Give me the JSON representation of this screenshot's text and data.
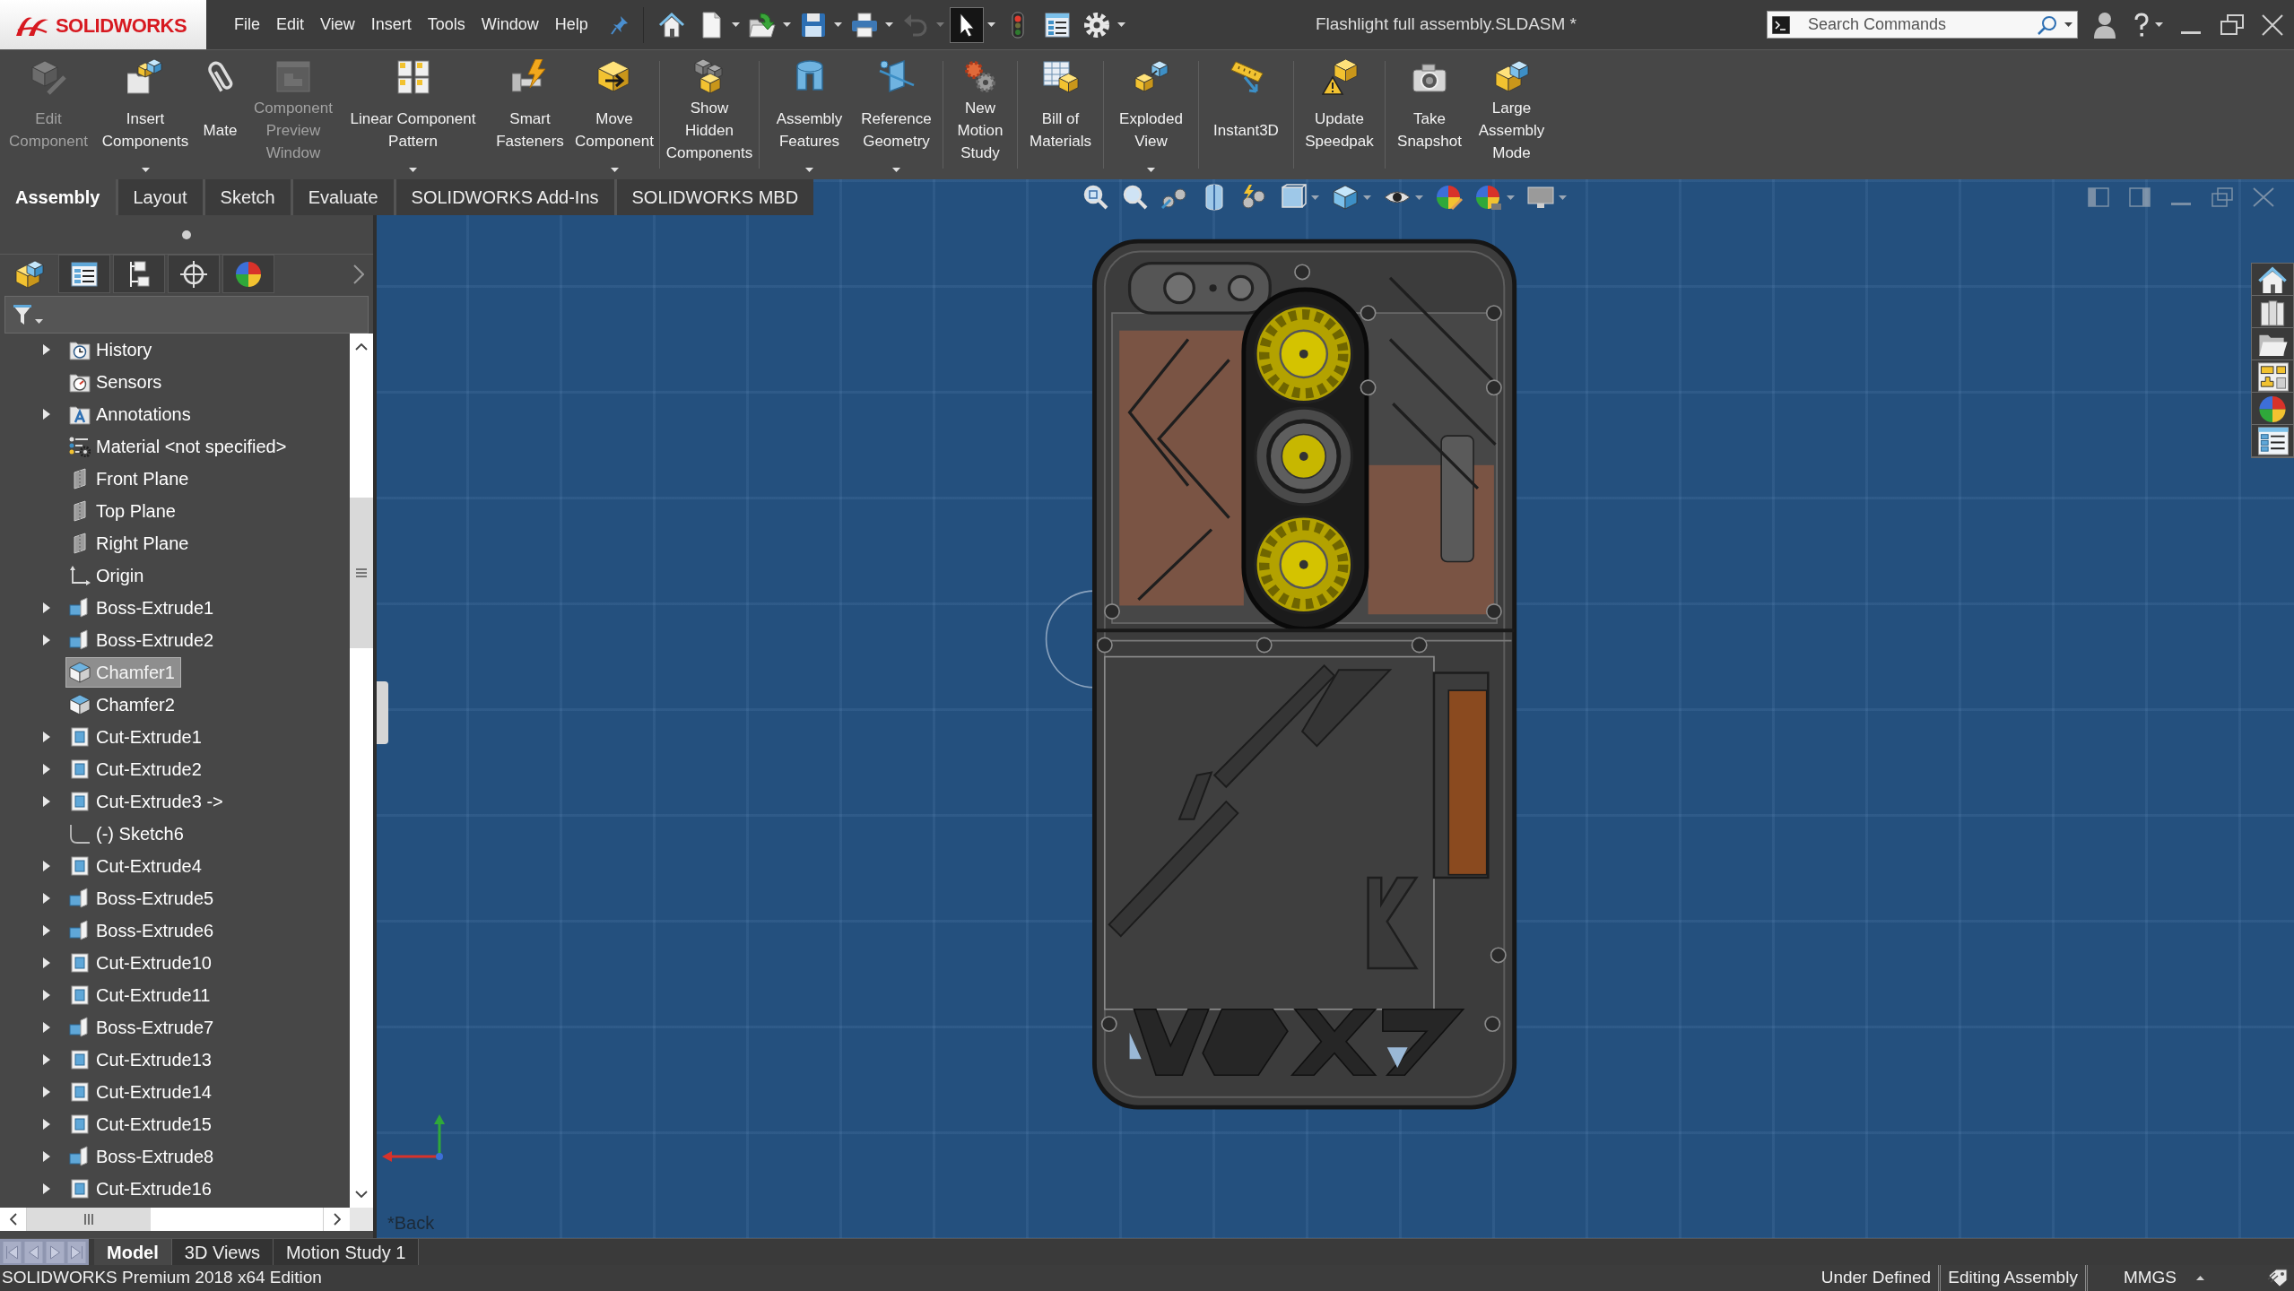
{
  "title_bar": {
    "logo": "SOLIDWORKS",
    "menu": [
      "File",
      "Edit",
      "View",
      "Insert",
      "Tools",
      "Window",
      "Help"
    ],
    "quick_access": [
      {
        "dropdown": false,
        "disabled": false,
        "selected": false
      },
      {
        "dropdown": true,
        "disabled": false,
        "selected": false
      },
      {
        "dropdown": true,
        "disabled": false,
        "selected": false
      },
      {
        "dropdown": true,
        "disabled": false,
        "selected": false
      },
      {
        "dropdown": true,
        "disabled": false,
        "selected": false
      },
      {
        "dropdown": true,
        "disabled": true,
        "selected": false
      },
      {
        "dropdown": true,
        "disabled": false,
        "selected": true
      },
      {
        "dropdown": false,
        "disabled": false,
        "selected": false
      },
      {
        "dropdown": false,
        "disabled": false,
        "selected": false
      },
      {
        "dropdown": true,
        "disabled": false,
        "selected": false
      }
    ],
    "document_title": "Flashlight full assembly.SLDASM *",
    "search": {
      "placeholder": "Search Commands"
    }
  },
  "ribbon": {
    "groups": [
      {
        "items": [
          {
            "label": "Edit Component",
            "disabled": true,
            "dropdown": false
          },
          {
            "label": "Insert Components",
            "disabled": false,
            "dropdown": true
          },
          {
            "label": "Mate",
            "disabled": false,
            "dropdown": false
          },
          {
            "label": "Component Preview Window",
            "disabled": true,
            "dropdown": false
          },
          {
            "label": "Linear Component Pattern",
            "disabled": false,
            "dropdown": true
          },
          {
            "label": "Smart Fasteners",
            "disabled": false,
            "dropdown": false
          },
          {
            "label": "Move Component",
            "disabled": false,
            "dropdown": true
          }
        ]
      },
      {
        "items": [
          {
            "label": "Show Hidden Components",
            "disabled": false,
            "dropdown": false
          }
        ]
      },
      {
        "items": [
          {
            "label": "Assembly Features",
            "disabled": false,
            "dropdown": true
          },
          {
            "label": "Reference Geometry",
            "disabled": false,
            "dropdown": true
          }
        ]
      },
      {
        "items": [
          {
            "label": "New Motion Study",
            "disabled": false,
            "dropdown": false
          }
        ]
      },
      {
        "items": [
          {
            "label": "Bill of Materials",
            "disabled": false,
            "dropdown": false
          }
        ]
      },
      {
        "items": [
          {
            "label": "Exploded View",
            "disabled": false,
            "dropdown": true
          }
        ]
      },
      {
        "items": [
          {
            "label": "Instant3D",
            "disabled": false,
            "dropdown": false
          }
        ]
      },
      {
        "items": [
          {
            "label": "Update Speedpak",
            "disabled": false,
            "dropdown": false
          }
        ]
      },
      {
        "items": [
          {
            "label": "Take Snapshot",
            "disabled": false,
            "dropdown": false
          },
          {
            "label": "Large Assembly Mode",
            "disabled": false,
            "dropdown": false
          }
        ]
      }
    ]
  },
  "command_tabs": [
    {
      "label": "Assembly",
      "selected": true
    },
    {
      "label": "Layout",
      "selected": false
    },
    {
      "label": "Sketch",
      "selected": false
    },
    {
      "label": "Evaluate",
      "selected": false
    },
    {
      "label": "SOLIDWORKS Add-Ins",
      "selected": false
    },
    {
      "label": "SOLIDWORKS MBD",
      "selected": false
    }
  ],
  "feature_tree": {
    "panel_tabs": [
      {
        "selected": true
      },
      {
        "selected": false
      },
      {
        "selected": false
      },
      {
        "selected": false
      },
      {
        "selected": false
      }
    ],
    "items": [
      {
        "label": "History",
        "kind": "history",
        "expandable": true,
        "selected": false
      },
      {
        "label": "Sensors",
        "kind": "sensors",
        "expandable": false,
        "selected": false
      },
      {
        "label": "Annotations",
        "kind": "annotations",
        "expandable": true,
        "selected": false
      },
      {
        "label": "Material <not specified>",
        "kind": "material",
        "expandable": false,
        "selected": false
      },
      {
        "label": "Front Plane",
        "kind": "plane",
        "expandable": false,
        "selected": false
      },
      {
        "label": "Top Plane",
        "kind": "plane",
        "expandable": false,
        "selected": false
      },
      {
        "label": "Right Plane",
        "kind": "plane",
        "expandable": false,
        "selected": false
      },
      {
        "label": "Origin",
        "kind": "origin",
        "expandable": false,
        "selected": false
      },
      {
        "label": "Boss-Extrude1",
        "kind": "boss",
        "expandable": true,
        "selected": false
      },
      {
        "label": "Boss-Extrude2",
        "kind": "boss",
        "expandable": true,
        "selected": false
      },
      {
        "label": "Chamfer1",
        "kind": "chamfer",
        "expandable": false,
        "selected": true
      },
      {
        "label": "Chamfer2",
        "kind": "chamfer",
        "expandable": false,
        "selected": false
      },
      {
        "label": "Cut-Extrude1",
        "kind": "cut",
        "expandable": true,
        "selected": false
      },
      {
        "label": "Cut-Extrude2",
        "kind": "cut",
        "expandable": true,
        "selected": false
      },
      {
        "label": "Cut-Extrude3 ->",
        "kind": "cut",
        "expandable": true,
        "selected": false
      },
      {
        "label": "(-) Sketch6",
        "kind": "sketch",
        "expandable": false,
        "selected": false
      },
      {
        "label": "Cut-Extrude4",
        "kind": "cut",
        "expandable": true,
        "selected": false
      },
      {
        "label": "Boss-Extrude5",
        "kind": "boss",
        "expandable": true,
        "selected": false
      },
      {
        "label": "Boss-Extrude6",
        "kind": "boss",
        "expandable": true,
        "selected": false
      },
      {
        "label": "Cut-Extrude10",
        "kind": "cut",
        "expandable": true,
        "selected": false
      },
      {
        "label": "Cut-Extrude11",
        "kind": "cut",
        "expandable": true,
        "selected": false
      },
      {
        "label": "Boss-Extrude7",
        "kind": "boss",
        "expandable": true,
        "selected": false
      },
      {
        "label": "Cut-Extrude13",
        "kind": "cut",
        "expandable": true,
        "selected": false
      },
      {
        "label": "Cut-Extrude14",
        "kind": "cut",
        "expandable": true,
        "selected": false
      },
      {
        "label": "Cut-Extrude15",
        "kind": "cut",
        "expandable": true,
        "selected": false
      },
      {
        "label": "Boss-Extrude8",
        "kind": "boss",
        "expandable": true,
        "selected": false
      },
      {
        "label": "Cut-Extrude16",
        "kind": "cut",
        "expandable": true,
        "selected": false
      }
    ]
  },
  "viewport": {
    "view_label": "*Back"
  },
  "bottom_tabs": [
    {
      "label": "Model",
      "selected": true
    },
    {
      "label": "3D Views",
      "selected": false
    },
    {
      "label": "Motion Study 1",
      "selected": false
    }
  ],
  "status_bar": {
    "edition": "SOLIDWORKS Premium 2018 x64 Edition",
    "fields": [
      "Under Defined",
      "Editing Assembly",
      "MMGS"
    ]
  }
}
